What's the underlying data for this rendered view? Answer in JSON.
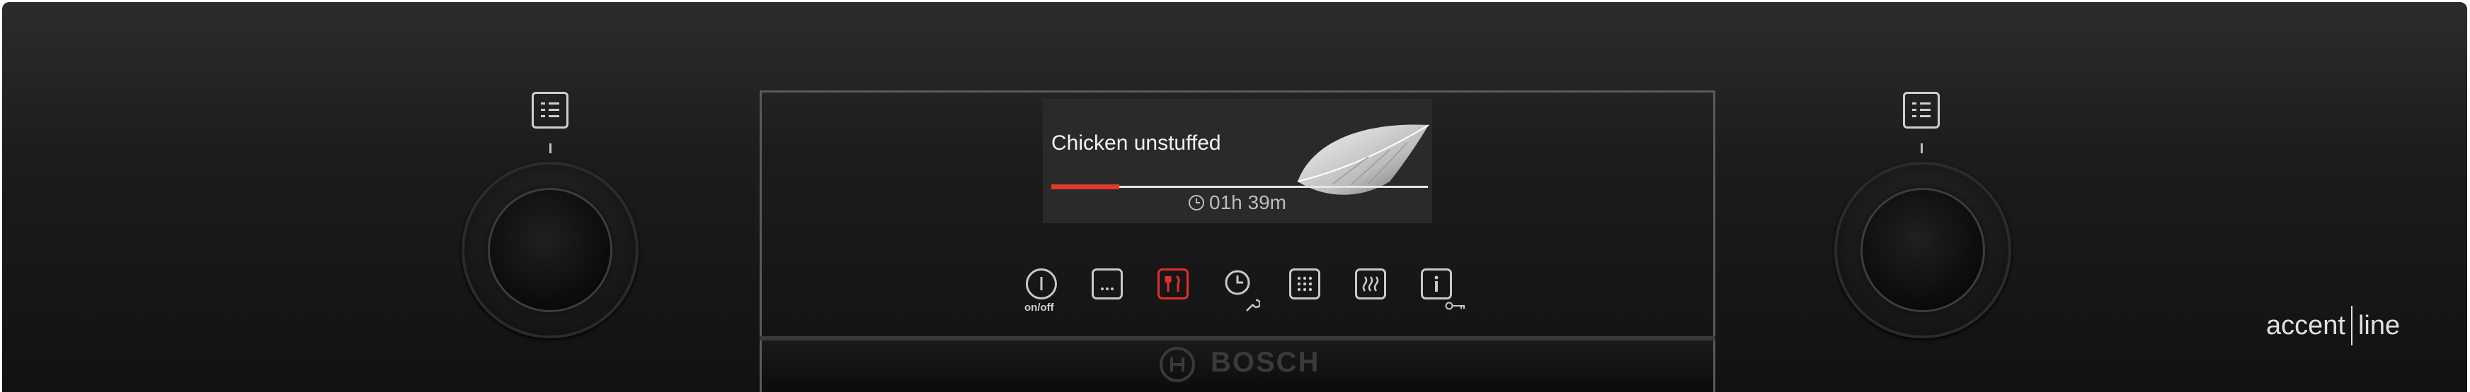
{
  "display": {
    "program_title": "Chicken unstuffed",
    "timer": "01h 39m",
    "progress_fraction": 0.18
  },
  "buttons": [
    {
      "icon": "power-icon",
      "label": "on/off"
    },
    {
      "icon": "more-icon",
      "label": ""
    },
    {
      "icon": "cooking-assist-icon",
      "label": "",
      "active": true
    },
    {
      "icon": "timer-icon",
      "label": ""
    },
    {
      "icon": "heating-modes-icon",
      "label": ""
    },
    {
      "icon": "steam-icon",
      "label": ""
    },
    {
      "icon": "info-icon",
      "label": ""
    }
  ],
  "brand": {
    "name": "BOSCH",
    "series_left": "accent",
    "series_right": "line"
  },
  "colors": {
    "accent_red": "#e0302a",
    "panel": "#1c1c1c"
  }
}
